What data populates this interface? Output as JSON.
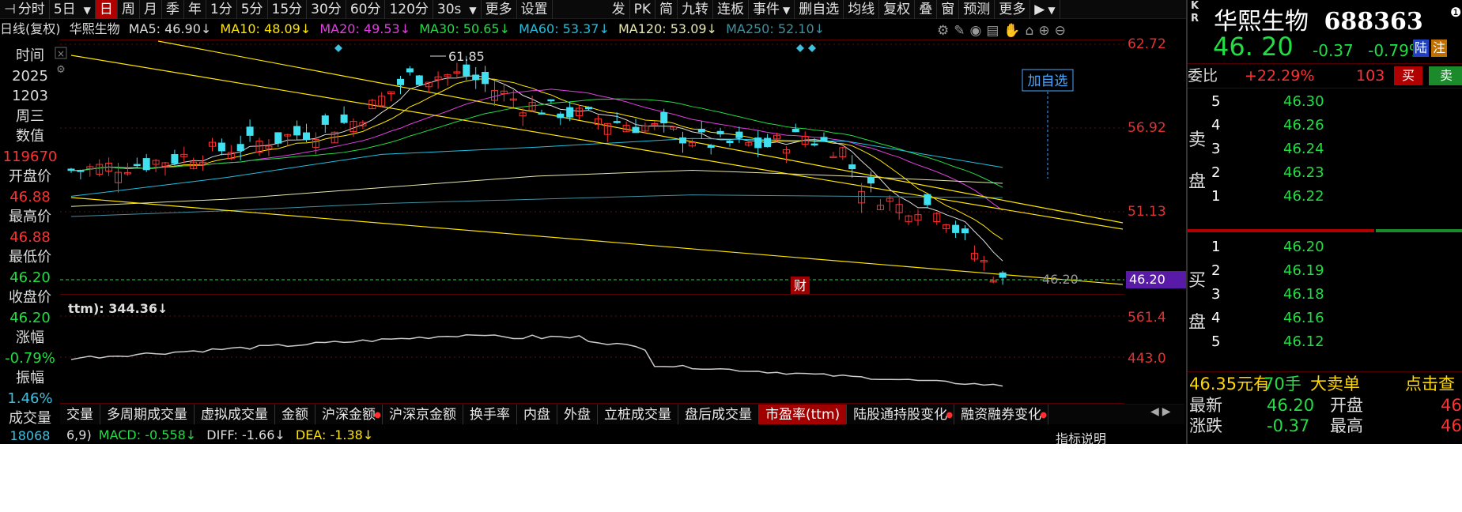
{
  "colors": {
    "up": "#ff3030",
    "down": "#22dd44",
    "accent": "#b00000",
    "ma5": "#dddddd",
    "ma10": "#ffe600",
    "ma20": "#e040e0",
    "ma30": "#22dd44",
    "ma60": "#20c0e0",
    "ma120": "#e8e8b0",
    "ma250": "#4090a0",
    "candle_up": "#ff3030",
    "candle_down": "#40e0f0"
  },
  "toolbar": {
    "items": [
      {
        "label": "分时",
        "icon": "pin-icon"
      },
      {
        "label": "5日",
        "dropdown": true
      },
      {
        "label": "日",
        "active": true
      },
      {
        "label": "周"
      },
      {
        "label": "月"
      },
      {
        "label": "季"
      },
      {
        "label": "年"
      },
      {
        "label": "1分"
      },
      {
        "label": "5分"
      },
      {
        "label": "15分"
      },
      {
        "label": "30分"
      },
      {
        "label": "60分"
      },
      {
        "label": "120分"
      },
      {
        "label": "30s",
        "dropdown": true
      },
      {
        "label": "更多"
      },
      {
        "label": "设置"
      }
    ],
    "items_right": [
      {
        "label": "发"
      },
      {
        "label": "PK"
      },
      {
        "label": "简"
      },
      {
        "label": "九转"
      },
      {
        "label": "连板"
      },
      {
        "label": "事件",
        "dropdown": true
      },
      {
        "label": "删自选"
      },
      {
        "label": "均线"
      },
      {
        "label": "复权"
      },
      {
        "label": "叠"
      },
      {
        "label": "窗"
      },
      {
        "label": "预测"
      },
      {
        "label": "更多"
      },
      {
        "label": "▶",
        "dropdown": true
      }
    ]
  },
  "ma_line": {
    "period": "日线(复权)",
    "name": "华熙生物",
    "ma5": "MA5: 46.90↓",
    "ma10": "MA10: 48.09↓",
    "ma20": "MA20: 49.53↓",
    "ma30": "MA30: 50.65↓",
    "ma60": "MA60: 53.37↓",
    "ma120": "MA120: 53.09↓",
    "ma250": "MA250: 52.10↓"
  },
  "chart_tools": [
    "gear-icon",
    "pen-icon",
    "eye-icon",
    "save-icon",
    "hand-icon",
    "lock-icon",
    "zoom-in-icon",
    "zoom-out-icon"
  ],
  "left_info": {
    "time_label": "时间",
    "year": "2025",
    "date": "1203",
    "weekday": "周三",
    "value_label": "数值",
    "value": "119670",
    "open_label": "开盘价",
    "open": "46.88",
    "high_label": "最高价",
    "high": "46.88",
    "low_label": "最低价",
    "low": "46.20",
    "close_label": "收盘价",
    "close": "46.20",
    "change_label": "涨幅",
    "change": "-0.79%",
    "amplitude_label": "振幅",
    "amplitude": "1.46%",
    "volume_label": "成交量",
    "volume": "18068"
  },
  "price_scale": {
    "ticks": [
      "62.72",
      "56.92",
      "51.13"
    ],
    "current": "46.20",
    "pe_ticks": [
      "561.4",
      "443.0"
    ]
  },
  "chart_annotations": {
    "peak_label": "61.85",
    "last_label": "46.20",
    "add_watch": "加自选",
    "fin_marker": "财"
  },
  "pe_indicator": {
    "label": "ttm): 344.36↓"
  },
  "tabs": [
    {
      "label": "交量"
    },
    {
      "label": "多周期成交量"
    },
    {
      "label": "虚拟成交量"
    },
    {
      "label": "金额"
    },
    {
      "label": "沪深金额",
      "dot": true
    },
    {
      "label": "沪深京金额"
    },
    {
      "label": "换手率"
    },
    {
      "label": "内盘"
    },
    {
      "label": "外盘"
    },
    {
      "label": "立桩成交量"
    },
    {
      "label": "盘后成交量"
    },
    {
      "label": "市盈率(ttm)",
      "active": true
    },
    {
      "label": "陆股通持股变化",
      "dot": true
    },
    {
      "label": "融资融券变化",
      "dot": true
    }
  ],
  "macd_line": {
    "prefix": "6,9)",
    "macd": "MACD: -0.558↓",
    "diff": "DIFF: -1.66↓",
    "dea": "DEA: -1.38↓",
    "explain": "指标说明"
  },
  "right_panel": {
    "kr": "K\nR",
    "name": "华熙生物",
    "code": "688363",
    "price": "46. 20",
    "change": "-0.37",
    "change_pct": "-0.79%",
    "tags": [
      "陆",
      "注"
    ],
    "weibi_label": "委比",
    "weibi": "+22.29%",
    "weicha": "103",
    "buy_btn": "买",
    "sell_btn": "卖",
    "sell_side_label": [
      "卖",
      "盘"
    ],
    "buy_side_label": [
      "买",
      "盘"
    ],
    "asks": [
      {
        "level": "5",
        "price": "46.30"
      },
      {
        "level": "4",
        "price": "46.26"
      },
      {
        "level": "3",
        "price": "46.24"
      },
      {
        "level": "2",
        "price": "46.23"
      },
      {
        "level": "1",
        "price": "46.22"
      }
    ],
    "bids": [
      {
        "level": "1",
        "price": "46.20"
      },
      {
        "level": "2",
        "price": "46.19"
      },
      {
        "level": "3",
        "price": "46.18"
      },
      {
        "level": "4",
        "price": "46.16"
      },
      {
        "level": "5",
        "price": "46.12"
      }
    ],
    "big_order": {
      "amount": "46.35元有",
      "qty": "70手",
      "label": "大卖单",
      "action": "点击查"
    },
    "quote": [
      {
        "k": "最新",
        "v": "46.20",
        "k2": "开盘",
        "v2": "46"
      },
      {
        "k": "涨跌",
        "v": "-0.37",
        "k2": "最高",
        "v2": "46"
      }
    ]
  }
}
